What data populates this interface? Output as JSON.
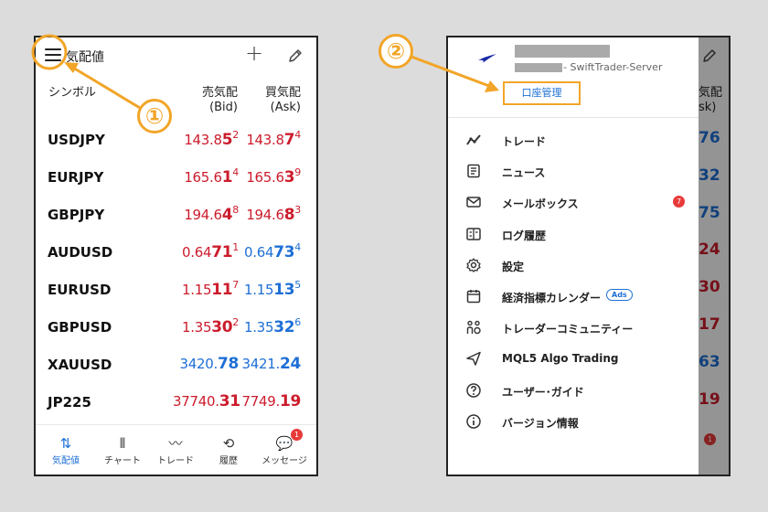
{
  "left_screen": {
    "header_title": "気配値",
    "columns": {
      "symbol": "シンボル",
      "sell_line1": "売気配",
      "sell_line2": "(Bid)",
      "buy_line1": "買気配",
      "buy_line2": "(Ask)"
    },
    "rows": [
      {
        "symbol": "USDJPY",
        "bid_a": "143.8",
        "bid_b": "5",
        "bid_c": "2",
        "bid_color": "red",
        "ask_a": "143.8",
        "ask_b": "7",
        "ask_c": "4",
        "ask_color": "red"
      },
      {
        "symbol": "EURJPY",
        "bid_a": "165.6",
        "bid_b": "1",
        "bid_c": "4",
        "bid_color": "red",
        "ask_a": "165.6",
        "ask_b": "3",
        "ask_c": "9",
        "ask_color": "red"
      },
      {
        "symbol": "GBPJPY",
        "bid_a": "194.6",
        "bid_b": "4",
        "bid_c": "8",
        "bid_color": "red",
        "ask_a": "194.6",
        "ask_b": "8",
        "ask_c": "3",
        "ask_color": "red"
      },
      {
        "symbol": "AUDUSD",
        "bid_a": "0.64",
        "bid_b": "71",
        "bid_c": "1",
        "bid_color": "red",
        "ask_a": "0.64",
        "ask_b": "73",
        "ask_c": "4",
        "ask_color": "blue"
      },
      {
        "symbol": "EURUSD",
        "bid_a": "1.15",
        "bid_b": "11",
        "bid_c": "7",
        "bid_color": "red",
        "ask_a": "1.15",
        "ask_b": "13",
        "ask_c": "5",
        "ask_color": "blue"
      },
      {
        "symbol": "GBPUSD",
        "bid_a": "1.35",
        "bid_b": "30",
        "bid_c": "2",
        "bid_color": "red",
        "ask_a": "1.35",
        "ask_b": "32",
        "ask_c": "6",
        "ask_color": "blue"
      },
      {
        "symbol": "XAUUSD",
        "bid_a": "3420.",
        "bid_b": "78",
        "bid_c": "",
        "bid_color": "blue",
        "ask_a": "3421.",
        "ask_b": "24",
        "ask_c": "",
        "ask_color": "blue"
      },
      {
        "symbol": "JP225",
        "bid_a": "37740.",
        "bid_b": "31",
        "bid_c": "",
        "bid_color": "red",
        "ask_a": "7749.",
        "ask_b": "19",
        "ask_c": "",
        "ask_color": "red"
      }
    ],
    "nav": [
      {
        "label": "気配値",
        "icon": "quotes-icon",
        "glyph": "⇅"
      },
      {
        "label": "チャート",
        "icon": "chart-icon",
        "glyph": "⫴"
      },
      {
        "label": "トレード",
        "icon": "trade-icon",
        "glyph": "〰"
      },
      {
        "label": "履歴",
        "icon": "history-icon",
        "glyph": "⟲"
      },
      {
        "label": "メッセージ",
        "icon": "messages-icon",
        "glyph": "💬"
      }
    ],
    "messages_badge": "1"
  },
  "right_screen": {
    "server_name": "- SwiftTrader-Server",
    "account_button": "口座管理",
    "menu": [
      {
        "label": "トレード",
        "icon": "trade-icon"
      },
      {
        "label": "ニュース",
        "icon": "news-icon"
      },
      {
        "label": "メールボックス",
        "icon": "mail-icon",
        "badge": "7"
      },
      {
        "label": "ログ履歴",
        "icon": "journal-icon"
      },
      {
        "label": "設定",
        "icon": "settings-icon"
      },
      {
        "label": "経済指標カレンダー",
        "icon": "calendar-icon",
        "tag": "Ads"
      },
      {
        "label": "トレーダーコミュニティー",
        "icon": "community-icon"
      },
      {
        "label": "MQL5 Algo Trading",
        "icon": "algo-trading-icon"
      },
      {
        "label": "ユーザー･ガイド",
        "icon": "help-icon"
      },
      {
        "label": "バージョン情報",
        "icon": "info-icon"
      }
    ],
    "bg_fragments": {
      "header_1": "気配",
      "header_2": "sk)",
      "values": [
        "76",
        "32",
        "75",
        "24",
        "30",
        "17",
        "63",
        "19"
      ],
      "value_colors": [
        "blue",
        "blue",
        "blue",
        "red",
        "red",
        "red",
        "blue",
        "red"
      ],
      "nav_label": "ージ",
      "badge": "1"
    }
  },
  "annotations": {
    "step1": "①",
    "step2": "②"
  },
  "colors": {
    "accent_blue": "#1e6fd6",
    "price_red": "#cc1c2c",
    "annotation_orange": "#f2a528",
    "badge_red": "#e83a3a"
  }
}
